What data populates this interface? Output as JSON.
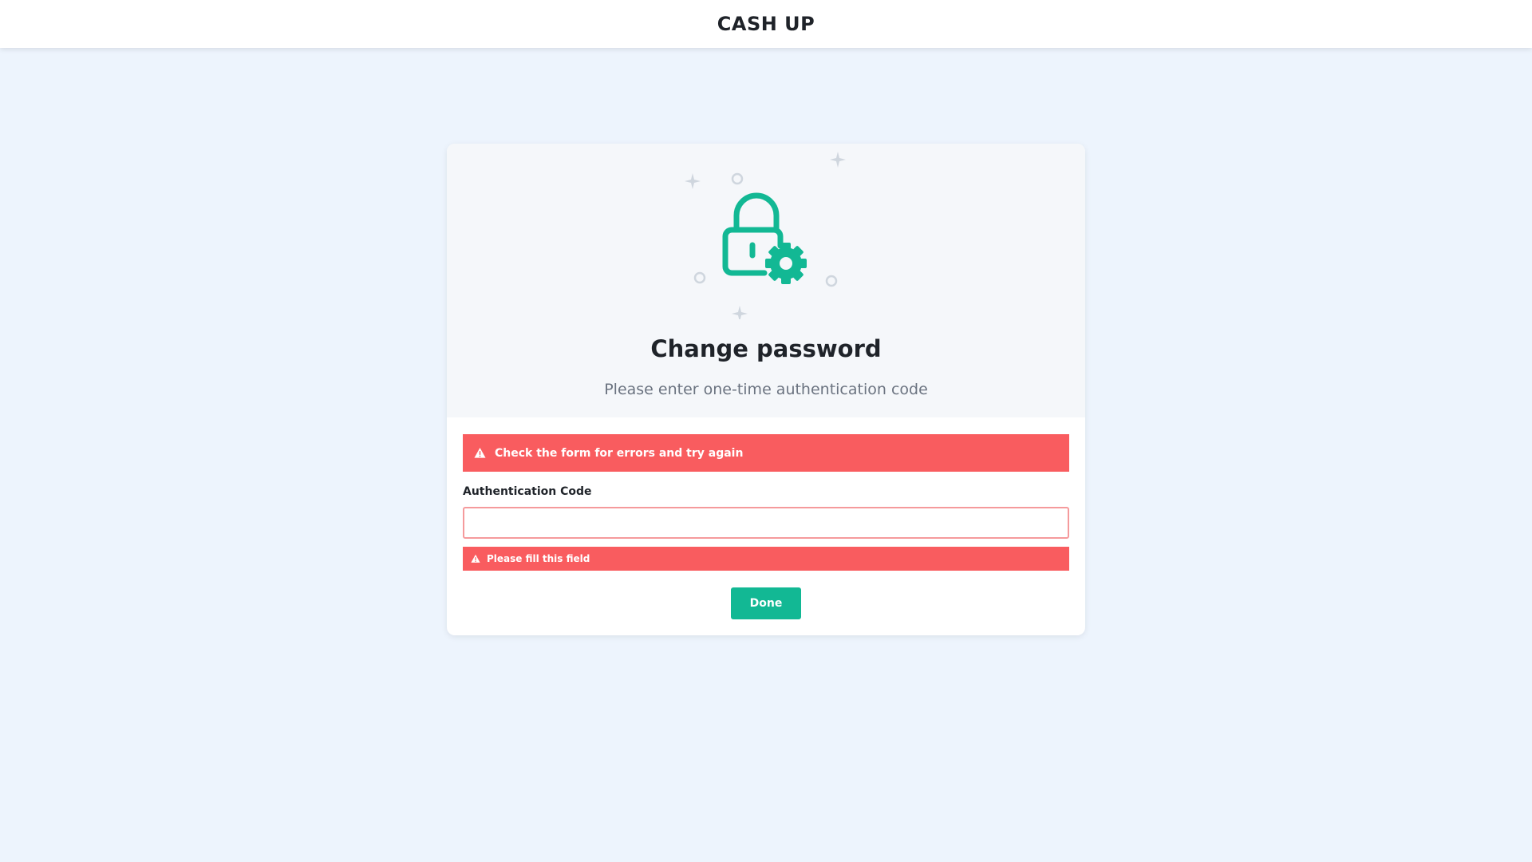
{
  "header": {
    "brand": "CASH UP"
  },
  "card": {
    "illustration_icon": "lock-gear-icon",
    "title": "Change password",
    "subtitle": "Please enter one-time authentication code"
  },
  "form": {
    "error_banner": "Check the form for errors and try again",
    "code_label": "Authentication Code",
    "code_value": "",
    "code_placeholder": "",
    "code_error": "Please fill this field",
    "submit_label": "Done"
  },
  "colors": {
    "accent": "#12b894",
    "error": "#f95c5f",
    "background": "#edf4fd",
    "text": "#1f2329",
    "muted": "#6b7380"
  }
}
